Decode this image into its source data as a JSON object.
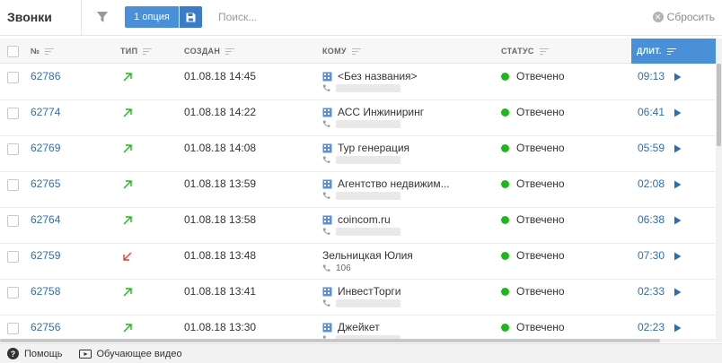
{
  "header": {
    "title": "Звонки",
    "option_label": "1 опция",
    "search_placeholder": "Поиск...",
    "reset_label": "Сбросить"
  },
  "columns": {
    "number": "№",
    "type": "ТИП",
    "created": "СОЗДАН",
    "to": "КОМУ",
    "status": "СТАТУС",
    "duration": "ДЛИТ."
  },
  "rows": [
    {
      "id": "62786",
      "type": "outgoing",
      "created": "01.08.18 14:45",
      "to": "<Без названия>",
      "to_icon": "building-icon",
      "sub": "",
      "status": "Отвечено",
      "duration": "09:13"
    },
    {
      "id": "62774",
      "type": "outgoing",
      "created": "01.08.18 14:22",
      "to": "АСС Инжиниринг",
      "to_icon": "building-icon",
      "sub": "",
      "status": "Отвечено",
      "duration": "06:41"
    },
    {
      "id": "62769",
      "type": "outgoing",
      "created": "01.08.18 14:08",
      "to": "Тур генерация",
      "to_icon": "building-icon",
      "sub": "",
      "status": "Отвечено",
      "duration": "05:59"
    },
    {
      "id": "62765",
      "type": "outgoing",
      "created": "01.08.18 13:59",
      "to": "Агентство недвижим...",
      "to_icon": "building-icon",
      "sub": "",
      "status": "Отвечено",
      "duration": "02:08"
    },
    {
      "id": "62764",
      "type": "outgoing",
      "created": "01.08.18 13:58",
      "to": "coincom.ru",
      "to_icon": "building-icon",
      "sub": "",
      "status": "Отвечено",
      "duration": "06:38"
    },
    {
      "id": "62759",
      "type": "incoming",
      "created": "01.08.18 13:48",
      "to": "Зельницкая Юлия",
      "to_icon": "",
      "sub": "106",
      "status": "Отвечено",
      "duration": "07:30"
    },
    {
      "id": "62758",
      "type": "outgoing",
      "created": "01.08.18 13:41",
      "to": "ИнвестТорги",
      "to_icon": "building-icon",
      "sub": "",
      "status": "Отвечено",
      "duration": "02:33"
    },
    {
      "id": "62756",
      "type": "outgoing",
      "created": "01.08.18 13:30",
      "to": "Джейкет",
      "to_icon": "building-icon",
      "sub": "",
      "status": "Отвечено",
      "duration": "02:23"
    }
  ],
  "footer": {
    "help_label": "Помощь",
    "video_label": "Обучающее видео"
  },
  "colors": {
    "accent": "#4a90d9",
    "link": "#2f6eb5",
    "status_answered": "#1db81d",
    "outgoing_arrow": "#1db81d",
    "incoming_arrow": "#e0403a"
  }
}
